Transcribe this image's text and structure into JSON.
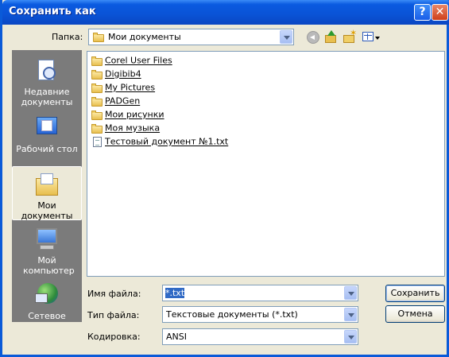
{
  "window": {
    "title": "Сохранить как",
    "help_label": "?",
    "close_label": "✕"
  },
  "location": {
    "label": "Папка:",
    "value": "Мои документы",
    "icon": "my-documents-folder-icon"
  },
  "toolbar": {
    "back_icon": "back-icon",
    "up_icon": "up-folder-icon",
    "new_folder_icon": "new-folder-icon",
    "view_menu_icon": "view-menu-icon"
  },
  "places": [
    {
      "label": "Недавние документы",
      "icon": "recent-documents-icon"
    },
    {
      "label": "Рабочий стол",
      "icon": "desktop-icon"
    },
    {
      "label": "Мои документы",
      "icon": "my-documents-icon",
      "selected": true
    },
    {
      "label": "Мой компьютер",
      "icon": "my-computer-icon"
    },
    {
      "label": "Сетевое",
      "icon": "network-icon"
    }
  ],
  "files": [
    {
      "name": "Corel User Files",
      "type": "folder"
    },
    {
      "name": "Digibib4",
      "type": "folder"
    },
    {
      "name": "My Pictures",
      "type": "folder"
    },
    {
      "name": "PADGen",
      "type": "folder"
    },
    {
      "name": "Мои рисунки",
      "type": "folder"
    },
    {
      "name": "Моя музыка",
      "type": "folder"
    },
    {
      "name": "Тестовый документ №1.txt",
      "type": "text-file"
    }
  ],
  "form": {
    "filename_label": "Имя файла:",
    "filename_value": "*.txt",
    "filetype_label": "Тип файла:",
    "filetype_value": "Текстовые документы (*.txt)",
    "encoding_label": "Кодировка:",
    "encoding_value": "ANSI"
  },
  "buttons": {
    "save": "Сохранить",
    "cancel": "Отмена"
  }
}
